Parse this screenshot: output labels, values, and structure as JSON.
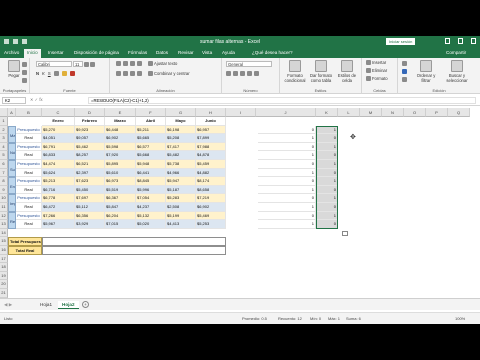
{
  "title": {
    "text": "sumar filas alternas - Excel",
    "sign_in": "Iniciar sesión"
  },
  "tabs": [
    "Archivo",
    "Inicio",
    "Insertar",
    "Disposición de página",
    "Fórmulas",
    "Datos",
    "Revisar",
    "Vista",
    "Ayuda",
    "¿Qué desea hacer?",
    "Compartir"
  ],
  "ribbon": {
    "paste": "Pegar",
    "clipboard": "Portapapeles",
    "font_name": "Calibri",
    "font_size": "11",
    "font": "Fuente",
    "wrap": "Ajustar texto",
    "merge": "Combinar y centrar",
    "alignment": "Alineación",
    "number_format": "General",
    "number": "Número",
    "cond_format": "Formato condicional",
    "table_format": "Dar formato como tabla",
    "cell_styles": "Estilos de celda",
    "styles": "Estilos",
    "insert": "Insertar",
    "delete": "Eliminar",
    "format": "Formato",
    "cells": "Celdas",
    "sort": "Ordenar y filtrar",
    "find": "Buscar y seleccionar",
    "editing": "Edición"
  },
  "formula_bar": {
    "name_box": "K2",
    "formula": "=RESIDUO(FILA(C2)-C1)+1,2)"
  },
  "columns": [
    "A",
    "B",
    "C",
    "D",
    "E",
    "F",
    "G",
    "H",
    "I",
    "J",
    "K",
    "L",
    "M",
    "N",
    "O",
    "P",
    "Q"
  ],
  "months": [
    "Enero",
    "Febrero",
    "Marzo",
    "Abril",
    "Mayo",
    "Junio"
  ],
  "categories": [
    "Marketing",
    "Nómina",
    "Suministros",
    "Envíos",
    "Impuestos",
    "Renta"
  ],
  "type_labels": {
    "presupuesto": "Presupuesto",
    "real": "Real"
  },
  "data_rows": [
    {
      "type": "presupuesto",
      "values": [
        "$5,270",
        "$9,923",
        "$6,448",
        "$5,211",
        "$6,198",
        "$6,957"
      ],
      "k": "0",
      "l": "1"
    },
    {
      "type": "real",
      "values": [
        "$4,051",
        "$9,057",
        "$6,902",
        "$5,665",
        "$5,208",
        "$7,899"
      ],
      "k": "1",
      "l": "0"
    },
    {
      "type": "presupuesto",
      "values": [
        "$6,791",
        "$5,462",
        "$5,598",
        "$6,577",
        "$7,417",
        "$7,988"
      ],
      "k": "0",
      "l": "1"
    },
    {
      "type": "real",
      "values": [
        "$6,833",
        "$8,257",
        "$7,920",
        "$5,668",
        "$5,482",
        "$4,878"
      ],
      "k": "1",
      "l": "0"
    },
    {
      "type": "presupuesto",
      "values": [
        "$4,474",
        "$6,521",
        "$5,895",
        "$5,948",
        "$5,738",
        "$5,459"
      ],
      "k": "0",
      "l": "1"
    },
    {
      "type": "real",
      "values": [
        "$5,624",
        "$2,397",
        "$5,610",
        "$6,441",
        "$4,966",
        "$4,882"
      ],
      "k": "1",
      "l": "0"
    },
    {
      "type": "presupuesto",
      "values": [
        "$5,213",
        "$7,623",
        "$6,973",
        "$8,845",
        "$5,947",
        "$8,174"
      ],
      "k": "0",
      "l": "1"
    },
    {
      "type": "real",
      "values": [
        "$6,716",
        "$5,450",
        "$5,519",
        "$5,996",
        "$5,187",
        "$8,658"
      ],
      "k": "1",
      "l": "0"
    },
    {
      "type": "presupuesto",
      "values": [
        "$6,778",
        "$7,697",
        "$6,367",
        "$7,054",
        "$5,283",
        "$7,219"
      ],
      "k": "0",
      "l": "1"
    },
    {
      "type": "real",
      "values": [
        "$6,472",
        "$5,112",
        "$5,847",
        "$4,237",
        "$2,508",
        "$6,902"
      ],
      "k": "1",
      "l": "0"
    },
    {
      "type": "presupuesto",
      "values": [
        "$7,266",
        "$6,356",
        "$6,204",
        "$5,132",
        "$5,199",
        "$5,469"
      ],
      "k": "0",
      "l": "1"
    },
    {
      "type": "real",
      "values": [
        "$5,967",
        "$3,929",
        "$7,015",
        "$5,020",
        "$4,413",
        "$5,253"
      ],
      "k": "1",
      "l": "0"
    }
  ],
  "totals": {
    "presupuesto": "Total Presupuesto",
    "real": "Total Real"
  },
  "sheets": [
    "Hoja1",
    "Hoja2"
  ],
  "status": {
    "mode": "Listo",
    "promedio": "Promedio: 0.5",
    "recuento": "Recuento: 12",
    "min": "Mín: 0",
    "max": "Máx: 1",
    "suma": "Suma: 6",
    "zoom": "100%"
  }
}
